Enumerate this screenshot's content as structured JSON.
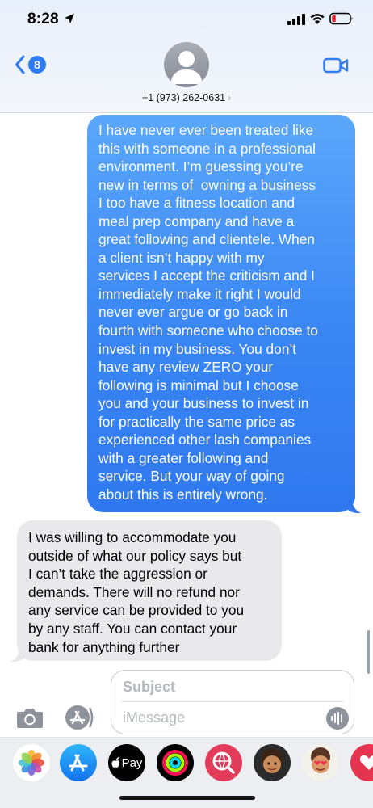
{
  "status_bar": {
    "time": "8:28"
  },
  "header": {
    "back_badge": "8",
    "contact_number": "+1 (973) 262-0631",
    "icons": [
      "back-chevron-icon",
      "person-icon",
      "video-camera-icon"
    ]
  },
  "messages": [
    {
      "direction": "outgoing",
      "lines": [
        "I have never ever been treated like",
        "this with someone in a professional",
        "environment. I’m guessing you’re",
        "new in terms of  owning a business",
        "I too have a fitness location and",
        "meal prep company and have a",
        "great following and clientele. When",
        "a client isn’t happy with my",
        "services I accept the criticism and I",
        "immediately make it right I would",
        "never ever argue or go back in",
        "fourth with someone who choose to",
        "invest in my business. You don’t",
        "have any review ZERO your",
        "following is minimal but I choose",
        "you and your business to invest in",
        "for practically the same price as",
        "experienced other lash companies",
        "with a greater following and",
        "service. But your way of going",
        "about this is entirely wrong."
      ]
    },
    {
      "direction": "incoming",
      "lines": [
        "I was willing to accommodate you",
        "outside of what our policy says but",
        "I can’t take the aggression or",
        "demands. There will no refund nor",
        "any service can be provided to you",
        "by any staff. You can contact your",
        "bank for anything further"
      ]
    }
  ],
  "composer": {
    "subject_placeholder": "Subject",
    "message_placeholder": "iMessage"
  },
  "app_drawer": {
    "apps": [
      {
        "name": "photos",
        "label": ""
      },
      {
        "name": "app-store",
        "label": ""
      },
      {
        "name": "apple-pay",
        "label": "Pay"
      },
      {
        "name": "activity",
        "label": ""
      },
      {
        "name": "search-images",
        "label": ""
      },
      {
        "name": "memoji-1",
        "label": ""
      },
      {
        "name": "memoji-2",
        "label": ""
      },
      {
        "name": "digital-touch",
        "label": ""
      }
    ]
  },
  "colors": {
    "outgoing_bubble": "#3a86f4",
    "incoming_bubble": "#e9e9eb",
    "accent": "#2f7bf6"
  }
}
